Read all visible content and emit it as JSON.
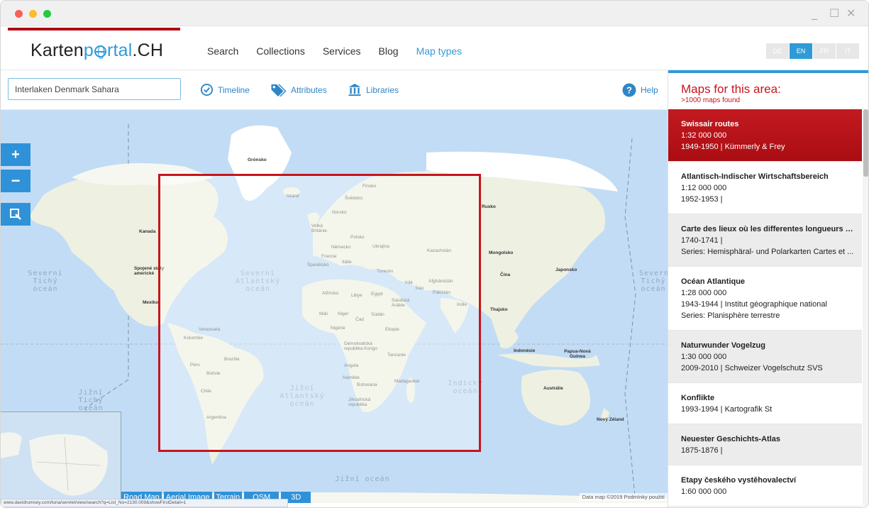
{
  "window": {
    "controls": [
      "_",
      "☐",
      "✕"
    ]
  },
  "header": {
    "logo": {
      "part1": "Karten",
      "part2": "rtal",
      "part3": ".CH"
    },
    "nav": [
      {
        "label": "Search",
        "active": false
      },
      {
        "label": "Collections",
        "active": false
      },
      {
        "label": "Services",
        "active": false
      },
      {
        "label": "Blog",
        "active": false
      },
      {
        "label": "Map types",
        "active": true
      }
    ],
    "languages": [
      {
        "code": "DE",
        "active": false
      },
      {
        "code": "EN",
        "active": true
      },
      {
        "code": "FR",
        "active": false
      },
      {
        "code": "IT",
        "active": false
      }
    ]
  },
  "toolbar": {
    "search_value": "Interlaken Denmark Sahara",
    "timeline_label": "Timeline",
    "attributes_label": "Attributes",
    "libraries_label": "Libraries",
    "help_label": "Help"
  },
  "map": {
    "zoom_in": "+",
    "zoom_out": "−",
    "select_tool": "◪",
    "layers": [
      "Road Map",
      "Aerial Image",
      "Terrain",
      "OSM",
      "3D"
    ],
    "attribution": "Data map ©2019   Podmínky použití",
    "status_url": "www.davidrumsey.com/luna/servlet/view/search?q=List_No=2130.009&showFirstDetail=1",
    "ocean_labels": [
      "Severní Tichý oceán",
      "Severní Atlantský oceán",
      "Jižní Tichý oceán",
      "Jižní Atlantský oceán",
      "Indický oceán",
      "Jižní oceán",
      "Severní Tichý oceán"
    ],
    "country_labels": {
      "gronsko": "Grónsko",
      "island": "Island",
      "finsko": "Finsko",
      "svedsko": "Švédsko",
      "norsko": "Norsko",
      "britanie": "Velká Británie",
      "polsko": "Polsko",
      "nemecko": "Německo",
      "ukrajina": "Ukrajina",
      "francie": "Francie",
      "spanelsko": "Španělsko",
      "italie": "Itálie",
      "kazachstan": "Kazachstán",
      "mongolsko": "Mongolsko",
      "cina": "Čína",
      "japonsko": "Japonsko",
      "turecko": "Turecko",
      "irak": "Irák",
      "iran": "Írán",
      "afghanistan": "Afghánistán",
      "pakistan": "Pákistán",
      "indie": "Indie",
      "saudska": "Saúdská Arábie",
      "alzirsko": "Alžírsko",
      "libye": "Libye",
      "egypt": "Egypt",
      "mali": "Mali",
      "niger": "Niger",
      "cad": "Čad",
      "sudan": "Súdán",
      "nigerie": "Nigérie",
      "etiopie": "Etiopie",
      "kongo": "Demokratická republika Kongo",
      "tanzanie": "Tanzanie",
      "angola": "Angola",
      "namibie": "Namibie",
      "botswana": "Botswana",
      "madagaskar": "Madagaskar",
      "jihoafricka": "Jihoafrická republika",
      "kanada": "Kanada",
      "usa": "Spojené státy americké",
      "mexiko": "Mexiko",
      "venezuela": "Venezuela",
      "kolumbie": "Kolumbie",
      "peru": "Peru",
      "brazilie": "Brazílie",
      "bolivie": "Bolívie",
      "chile": "Chile",
      "argentina": "Argentina",
      "thajsko": "Thajsko",
      "indonesie": "Indonésie",
      "papua": "Papua-Nová Guinea",
      "australie": "Austrálie",
      "zeland": "Nový Zéland",
      "rusko": "Rusko"
    }
  },
  "panel": {
    "title": "Maps for this area:",
    "subtitle": ">1000 maps found",
    "items": [
      {
        "title": "Swissair routes",
        "lines": [
          "1:32 000 000",
          "1949-1950 | Kümmerly & Frey"
        ],
        "selected": true
      },
      {
        "title": "Atlantisch-Indischer Wirtschaftsbereich",
        "lines": [
          "1:12 000 000",
          "1952-1953 |"
        ],
        "selected": false
      },
      {
        "title": "Carte des lieux où les differentes longueurs d...",
        "lines": [
          "1740-1741 |",
          "Series: Hemisphäral- und Polarkarten Cartes et ..."
        ],
        "selected": false
      },
      {
        "title": "Océan Atlantique",
        "lines": [
          "1:28 000 000",
          "1943-1944 | Institut géographique national",
          "Series: Planisphère terrestre"
        ],
        "selected": false
      },
      {
        "title": "Naturwunder Vogelzug",
        "lines": [
          "1:30 000 000",
          "2009-2010 | Schweizer Vogelschutz SVS"
        ],
        "selected": false
      },
      {
        "title": "Konflikte",
        "lines": [
          "1993-1994 | Kartografik St"
        ],
        "selected": false
      },
      {
        "title": "Neuester Geschichts-Atlas",
        "lines": [
          "1875-1876 |"
        ],
        "selected": false
      },
      {
        "title": "Etapy českého vystěhovalectví",
        "lines": [
          "1:60 000 000"
        ],
        "selected": false
      }
    ]
  },
  "colors": {
    "brand_blue": "#2f9bd6",
    "brand_red": "#c6151c",
    "ocean": "#c2dcf5",
    "land": "#eef1e2"
  }
}
